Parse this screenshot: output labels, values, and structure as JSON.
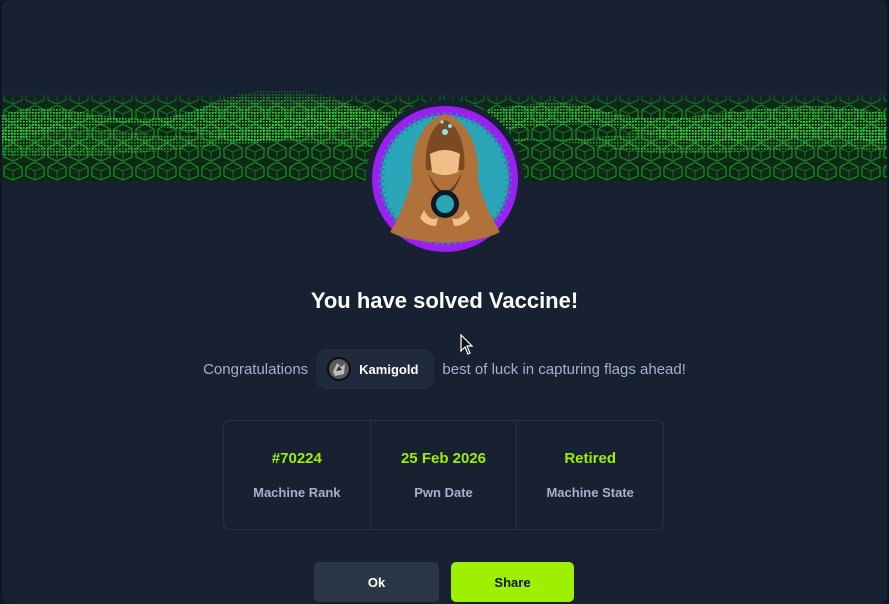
{
  "dialog": {
    "title": "You have solved Vaccine!",
    "congrats_prefix": "Congratulations",
    "username": "Kamigold",
    "congrats_suffix": "best of luck in capturing flags ahead!"
  },
  "stats": [
    {
      "value": "#70224",
      "label": "Machine Rank"
    },
    {
      "value": "25 Feb 2026",
      "label": "Pwn Date"
    },
    {
      "value": "Retired",
      "label": "Machine State"
    }
  ],
  "buttons": {
    "ok": "Ok",
    "share": "Share"
  },
  "colors": {
    "accent": "#9fef00",
    "avatar_ring": "#9b1ff2",
    "background": "#172131",
    "muted_text": "#a4b1cd"
  },
  "icons": {
    "machine_avatar": "hooded-figure-avatar",
    "user_avatar": "user-avatar",
    "cursor": "mouse-pointer-icon"
  }
}
